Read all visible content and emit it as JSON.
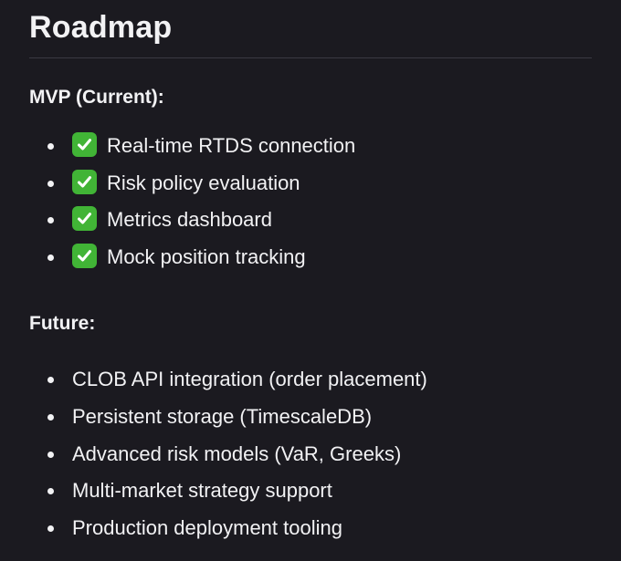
{
  "title": "Roadmap",
  "mvp": {
    "heading": "MVP (Current):",
    "items": [
      {
        "icon": "check-icon",
        "label": "Real-time RTDS connection"
      },
      {
        "icon": "check-icon",
        "label": "Risk policy evaluation"
      },
      {
        "icon": "check-icon",
        "label": "Metrics dashboard"
      },
      {
        "icon": "check-icon",
        "label": "Mock position tracking"
      }
    ]
  },
  "future": {
    "heading": "Future:",
    "items": [
      {
        "label": "CLOB API integration (order placement)"
      },
      {
        "label": "Persistent storage (TimescaleDB)"
      },
      {
        "label": "Advanced risk models (VaR, Greeks)"
      },
      {
        "label": "Multi-market strategy support"
      },
      {
        "label": "Production deployment tooling"
      }
    ]
  },
  "colors": {
    "background": "#1b1a20",
    "text": "#f2f2f4",
    "divider": "#3b3a42",
    "check": "#41b436"
  }
}
